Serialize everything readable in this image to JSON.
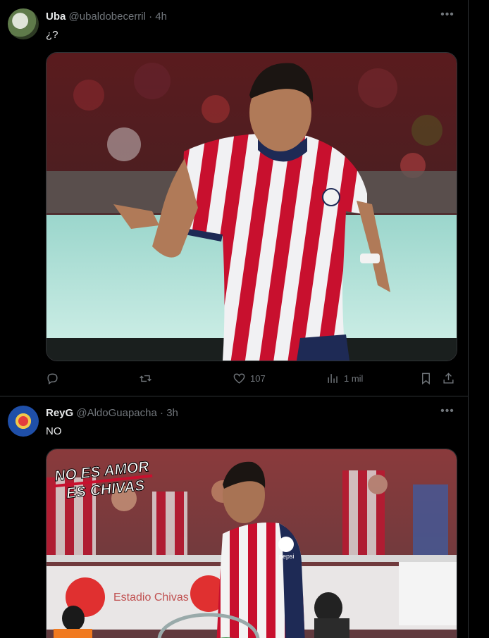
{
  "tweets": [
    {
      "name": "Uba",
      "handle": "@ubaldobecerril",
      "separator": "·",
      "time": "4h",
      "more": "•••",
      "text": "¿?",
      "likes": "107",
      "views": "1 mil"
    },
    {
      "name": "ReyG",
      "handle": "@AldoGuapacha",
      "separator": "·",
      "time": "3h",
      "more": "•••",
      "text": "NO",
      "banner_line1": "NO ES AMOR",
      "banner_line2": "ES CHIVAS",
      "sponsor": "pepsi",
      "sign1": "Estadio Chivas"
    }
  ],
  "colors": {
    "background": "#000000",
    "text": "#e7e9ea",
    "muted": "#71767b",
    "border": "#2f3336",
    "jersey_red": "#c8102e"
  }
}
